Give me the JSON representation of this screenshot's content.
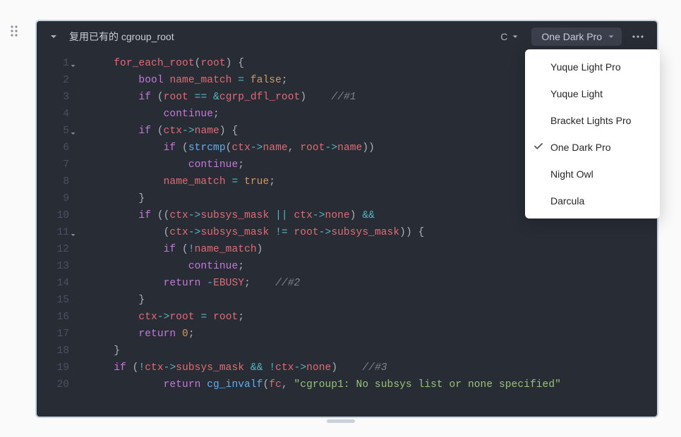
{
  "header": {
    "title": "复用已有的 cgroup_root",
    "language_label": "C",
    "theme_label": "One Dark Pro"
  },
  "theme_menu": {
    "selected": "One Dark Pro",
    "options": [
      "Yuque Light Pro",
      "Yuque Light",
      "Bracket Lights Pro",
      "One Dark Pro",
      "Night Owl",
      "Darcula"
    ]
  },
  "code": {
    "lines": [
      {
        "n": 1,
        "fold": true,
        "tokens": [
          [
            "    ",
            "p"
          ],
          [
            "for_each_root",
            "fnr"
          ],
          [
            "(",
            "p"
          ],
          [
            "root",
            "id"
          ],
          [
            ") {",
            "p"
          ]
        ]
      },
      {
        "n": 2,
        "tokens": [
          [
            "        ",
            "p"
          ],
          [
            "bool",
            "k"
          ],
          [
            " ",
            "p"
          ],
          [
            "name_match",
            "id"
          ],
          [
            " ",
            "p"
          ],
          [
            "=",
            "op"
          ],
          [
            " ",
            "p"
          ],
          [
            "false",
            "nm"
          ],
          [
            ";",
            "p"
          ]
        ]
      },
      {
        "n": 3,
        "tokens": [
          [
            "        ",
            "p"
          ],
          [
            "if",
            "k"
          ],
          [
            " (",
            "p"
          ],
          [
            "root",
            "id"
          ],
          [
            " ",
            "p"
          ],
          [
            "==",
            "op"
          ],
          [
            " ",
            "p"
          ],
          [
            "&",
            "op"
          ],
          [
            "cgrp_dfl_root",
            "id"
          ],
          [
            ")    ",
            "p"
          ],
          [
            "//#1",
            "cm"
          ]
        ]
      },
      {
        "n": 4,
        "tokens": [
          [
            "            ",
            "p"
          ],
          [
            "continue",
            "k"
          ],
          [
            ";",
            "p"
          ]
        ]
      },
      {
        "n": 5,
        "fold": true,
        "tokens": [
          [
            "        ",
            "p"
          ],
          [
            "if",
            "k"
          ],
          [
            " (",
            "p"
          ],
          [
            "ctx",
            "id"
          ],
          [
            "->",
            "op"
          ],
          [
            "name",
            "id"
          ],
          [
            ") {",
            "p"
          ]
        ]
      },
      {
        "n": 6,
        "tokens": [
          [
            "            ",
            "p"
          ],
          [
            "if",
            "k"
          ],
          [
            " (",
            "p"
          ],
          [
            "strcmp",
            "fn"
          ],
          [
            "(",
            "p"
          ],
          [
            "ctx",
            "id"
          ],
          [
            "->",
            "op"
          ],
          [
            "name",
            "id"
          ],
          [
            ", ",
            "p"
          ],
          [
            "root",
            "id"
          ],
          [
            "->",
            "op"
          ],
          [
            "name",
            "id"
          ],
          [
            "))",
            "p"
          ]
        ]
      },
      {
        "n": 7,
        "tokens": [
          [
            "                ",
            "p"
          ],
          [
            "continue",
            "k"
          ],
          [
            ";",
            "p"
          ]
        ]
      },
      {
        "n": 8,
        "tokens": [
          [
            "            ",
            "p"
          ],
          [
            "name_match",
            "id"
          ],
          [
            " ",
            "p"
          ],
          [
            "=",
            "op"
          ],
          [
            " ",
            "p"
          ],
          [
            "true",
            "nm"
          ],
          [
            ";",
            "p"
          ]
        ]
      },
      {
        "n": 9,
        "tokens": [
          [
            "        }",
            "p"
          ]
        ]
      },
      {
        "n": 10,
        "tokens": [
          [
            "        ",
            "p"
          ],
          [
            "if",
            "k"
          ],
          [
            " ((",
            "p"
          ],
          [
            "ctx",
            "id"
          ],
          [
            "->",
            "op"
          ],
          [
            "subsys_mask",
            "id"
          ],
          [
            " ",
            "p"
          ],
          [
            "||",
            "op"
          ],
          [
            " ",
            "p"
          ],
          [
            "ctx",
            "id"
          ],
          [
            "->",
            "op"
          ],
          [
            "none",
            "id"
          ],
          [
            ") ",
            "p"
          ],
          [
            "&&",
            "op"
          ]
        ]
      },
      {
        "n": 11,
        "fold": true,
        "tokens": [
          [
            "            (",
            "p"
          ],
          [
            "ctx",
            "id"
          ],
          [
            "->",
            "op"
          ],
          [
            "subsys_mask",
            "id"
          ],
          [
            " ",
            "p"
          ],
          [
            "!=",
            "op"
          ],
          [
            " ",
            "p"
          ],
          [
            "root",
            "id"
          ],
          [
            "->",
            "op"
          ],
          [
            "subsys_mask",
            "id"
          ],
          [
            ")) {",
            "p"
          ]
        ]
      },
      {
        "n": 12,
        "tokens": [
          [
            "            ",
            "p"
          ],
          [
            "if",
            "k"
          ],
          [
            " (",
            "p"
          ],
          [
            "!",
            "op"
          ],
          [
            "name_match",
            "id"
          ],
          [
            ")",
            "p"
          ]
        ]
      },
      {
        "n": 13,
        "tokens": [
          [
            "                ",
            "p"
          ],
          [
            "continue",
            "k"
          ],
          [
            ";",
            "p"
          ]
        ]
      },
      {
        "n": 14,
        "tokens": [
          [
            "            ",
            "p"
          ],
          [
            "return",
            "k"
          ],
          [
            " ",
            "p"
          ],
          [
            "-",
            "op"
          ],
          [
            "EBUSY",
            "id"
          ],
          [
            ";    ",
            "p"
          ],
          [
            "//#2",
            "cm"
          ]
        ]
      },
      {
        "n": 15,
        "tokens": [
          [
            "        }",
            "p"
          ]
        ]
      },
      {
        "n": 16,
        "tokens": [
          [
            "        ",
            "p"
          ],
          [
            "ctx",
            "id"
          ],
          [
            "->",
            "op"
          ],
          [
            "root",
            "id"
          ],
          [
            " ",
            "p"
          ],
          [
            "=",
            "op"
          ],
          [
            " ",
            "p"
          ],
          [
            "root",
            "id"
          ],
          [
            ";",
            "p"
          ]
        ]
      },
      {
        "n": 17,
        "tokens": [
          [
            "        ",
            "p"
          ],
          [
            "return",
            "k"
          ],
          [
            " ",
            "p"
          ],
          [
            "0",
            "nm"
          ],
          [
            ";",
            "p"
          ]
        ]
      },
      {
        "n": 18,
        "tokens": [
          [
            "    }",
            "p"
          ]
        ]
      },
      {
        "n": 19,
        "tokens": [
          [
            "    ",
            "p"
          ],
          [
            "if",
            "k"
          ],
          [
            " (",
            "p"
          ],
          [
            "!",
            "op"
          ],
          [
            "ctx",
            "id"
          ],
          [
            "->",
            "op"
          ],
          [
            "subsys_mask",
            "id"
          ],
          [
            " ",
            "p"
          ],
          [
            "&&",
            "op"
          ],
          [
            " ",
            "p"
          ],
          [
            "!",
            "op"
          ],
          [
            "ctx",
            "id"
          ],
          [
            "->",
            "op"
          ],
          [
            "none",
            "id"
          ],
          [
            ")    ",
            "p"
          ],
          [
            "//#3",
            "cm"
          ]
        ]
      },
      {
        "n": 20,
        "tokens": [
          [
            "            ",
            "p"
          ],
          [
            "return",
            "k"
          ],
          [
            " ",
            "p"
          ],
          [
            "cg_invalf",
            "fn"
          ],
          [
            "(",
            "p"
          ],
          [
            "fc",
            "id"
          ],
          [
            ", ",
            "p"
          ],
          [
            "\"cgroup1: No subsys list or none specified\"",
            "str"
          ]
        ]
      }
    ]
  }
}
